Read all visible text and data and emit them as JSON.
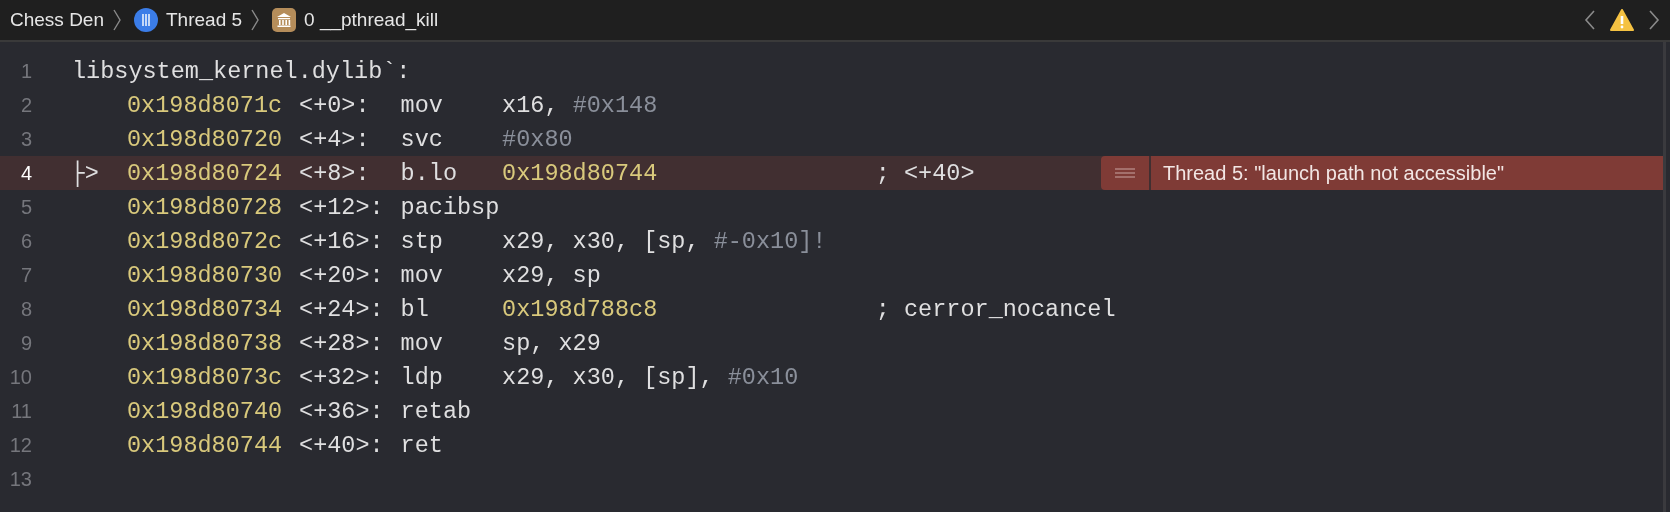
{
  "breadcrumb": [
    {
      "kind": "project",
      "label": "Chess Den"
    },
    {
      "kind": "thread",
      "label": "Thread 5"
    },
    {
      "kind": "frame",
      "label": "0 __pthread_kill"
    }
  ],
  "lines": [
    {
      "number": "1",
      "kind": "label",
      "text": "libsystem_kernel.dylib`:",
      "current": false
    },
    {
      "number": "2",
      "kind": "instruction",
      "address": "0x198d8071c",
      "offset": "<+0>:",
      "mnemonic": "mov",
      "operands": [
        {
          "text": "x16, ",
          "kind": "plain"
        },
        {
          "text": "#0x148",
          "kind": "immediate"
        }
      ],
      "current": false
    },
    {
      "number": "3",
      "kind": "instruction",
      "address": "0x198d80720",
      "offset": "<+4>:",
      "mnemonic": "svc",
      "operands": [
        {
          "text": "#0x80",
          "kind": "immediate"
        }
      ],
      "current": false
    },
    {
      "number": "4",
      "kind": "instruction",
      "pc_marker": "├>",
      "address": "0x198d80724",
      "offset": "<+8>:",
      "mnemonic": "b.lo",
      "operands": [
        {
          "text": "0x198d80744",
          "kind": "address"
        }
      ],
      "comment": "; <+40>",
      "annotation": {
        "text": "Thread 5: \"launch path not accessible\""
      },
      "current": true
    },
    {
      "number": "5",
      "kind": "instruction",
      "address": "0x198d80728",
      "offset": "<+12>:",
      "mnemonic": "pacibsp",
      "current": false
    },
    {
      "number": "6",
      "kind": "instruction",
      "address": "0x198d8072c",
      "offset": "<+16>:",
      "mnemonic": "stp",
      "operands": [
        {
          "text": "x29, x30, [sp, ",
          "kind": "plain"
        },
        {
          "text": "#-0x10]!",
          "kind": "immediate"
        }
      ],
      "current": false
    },
    {
      "number": "7",
      "kind": "instruction",
      "address": "0x198d80730",
      "offset": "<+20>:",
      "mnemonic": "mov",
      "operands": [
        {
          "text": "x29, sp",
          "kind": "plain"
        }
      ],
      "current": false
    },
    {
      "number": "8",
      "kind": "instruction",
      "address": "0x198d80734",
      "offset": "<+24>:",
      "mnemonic": "bl",
      "operands": [
        {
          "text": "0x198d788c8",
          "kind": "address"
        }
      ],
      "comment": "; cerror_nocancel",
      "current": false
    },
    {
      "number": "9",
      "kind": "instruction",
      "address": "0x198d80738",
      "offset": "<+28>:",
      "mnemonic": "mov",
      "operands": [
        {
          "text": "sp, x29",
          "kind": "plain"
        }
      ],
      "current": false
    },
    {
      "number": "10",
      "kind": "instruction",
      "address": "0x198d8073c",
      "offset": "<+32>:",
      "mnemonic": "ldp",
      "operands": [
        {
          "text": "x29, x30, [sp], ",
          "kind": "plain"
        },
        {
          "text": "#0x10",
          "kind": "immediate"
        }
      ],
      "current": false
    },
    {
      "number": "11",
      "kind": "instruction",
      "address": "0x198d80740",
      "offset": "<+36>:",
      "mnemonic": "retab",
      "current": false
    },
    {
      "number": "12",
      "kind": "instruction",
      "address": "0x198d80744",
      "offset": "<+40>:",
      "mnemonic": "ret",
      "current": false
    },
    {
      "number": "13",
      "kind": "empty",
      "current": false
    }
  ]
}
